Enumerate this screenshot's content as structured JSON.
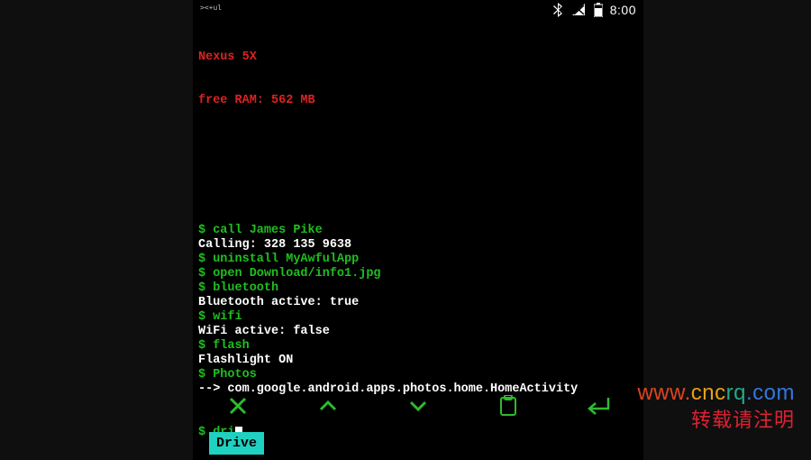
{
  "statusbar": {
    "tiny_label": "><+ul",
    "clock": "8:00"
  },
  "header": {
    "device": "Nexus 5X",
    "ram_line": "free RAM: 562 MB"
  },
  "terminal": {
    "lines": [
      {
        "type": "cmd",
        "text": "$ call James Pike"
      },
      {
        "type": "out",
        "text": "Calling: 328 135 9638"
      },
      {
        "type": "cmd",
        "text": "$ uninstall MyAwfulApp"
      },
      {
        "type": "cmd",
        "text": "$ open Download/info1.jpg"
      },
      {
        "type": "cmd",
        "text": "$ bluetooth"
      },
      {
        "type": "out",
        "text": "Bluetooth active: true"
      },
      {
        "type": "cmd",
        "text": "$ wifi"
      },
      {
        "type": "out",
        "text": "WiFi active: false"
      },
      {
        "type": "cmd",
        "text": "$ flash"
      },
      {
        "type": "out",
        "text": "Flashlight ON"
      },
      {
        "type": "cmd",
        "text": "$ Photos"
      },
      {
        "type": "out",
        "text": "--> com.google.android.apps.photos.home.HomeActivity"
      }
    ],
    "current_prompt": "$ ",
    "current_input": "dri"
  },
  "controls": {
    "close": "close-icon",
    "up": "chevron-up-icon",
    "down": "chevron-down-icon",
    "paste": "clipboard-icon",
    "enter": "enter-icon"
  },
  "suggestion": {
    "label": "Drive"
  },
  "watermark": {
    "url_parts": [
      "www.",
      "cnc",
      "rq",
      ".com"
    ],
    "subtitle": "转载请注明"
  },
  "colors": {
    "term_green": "#1fbf1f",
    "term_red": "#d22",
    "accent_teal": "#1fd1c0",
    "enter_green": "#2dbb2d"
  }
}
